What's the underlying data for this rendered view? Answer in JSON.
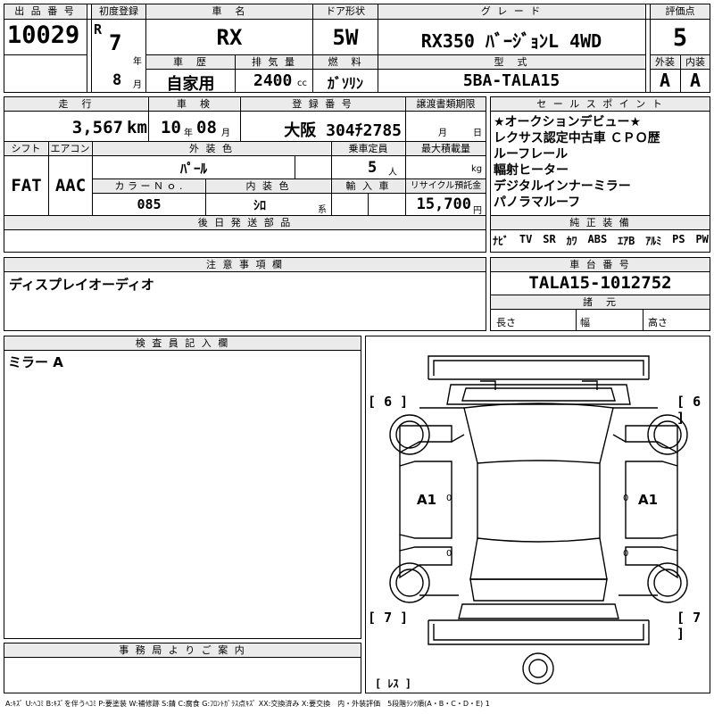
{
  "lot": {
    "header": "出 品 番 号",
    "value": "10029"
  },
  "first_reg": {
    "header": "初度登録",
    "era": "R",
    "year": "7",
    "year_unit": "年",
    "month": "8",
    "month_unit": "月"
  },
  "car_name": {
    "header": "車　名",
    "value": "RX"
  },
  "doors": {
    "header": "ドア形状",
    "value": "5W"
  },
  "grade": {
    "header": "グ レ ー ド",
    "value": "RX350 ﾊﾞｰｼﾞｮﾝL 4WD"
  },
  "score": {
    "header": "評価点",
    "value": "5"
  },
  "history": {
    "header": "車　歴",
    "value": "自家用"
  },
  "displacement": {
    "header": "排 気 量",
    "value": "2400",
    "unit": "cc"
  },
  "fuel": {
    "header": "燃　料",
    "value": "ｶﾞｿﾘﾝ"
  },
  "model": {
    "header": "型　式",
    "value": "5BA-TALA15"
  },
  "exterior_grade": {
    "header": "外装",
    "value": "A"
  },
  "interior_grade": {
    "header": "内装",
    "value": "A"
  },
  "mileage": {
    "header": "走　行",
    "value": "3,567",
    "unit": "km"
  },
  "inspection": {
    "header": "車　検",
    "year": "10",
    "year_unit": "年",
    "month": "08",
    "month_unit": "月"
  },
  "registration": {
    "header": "登 録 番 号",
    "value": "大阪 304ﾁ2785"
  },
  "transfer": {
    "header": "譲渡書類期限",
    "month_unit": "月",
    "day_unit": "日"
  },
  "shift": {
    "header": "シフト",
    "value": "FAT"
  },
  "aircon": {
    "header": "エアコン",
    "value": "AAC"
  },
  "color": {
    "header": "外 装 色",
    "value": "ﾊﾟｰﾙ"
  },
  "capacity": {
    "header": "乗車定員",
    "value": "5",
    "unit": "人"
  },
  "max_load": {
    "header": "最大積載量",
    "unit": "kg"
  },
  "color_no": {
    "header": "カ ラ ー Ｎ ｏ .",
    "value": "085"
  },
  "interior_color": {
    "header": "内 装 色",
    "value": "ｼﾛ",
    "unit": "系"
  },
  "import": {
    "header": "輸 入 車"
  },
  "recycle": {
    "header": "リサイクル預託金",
    "value": "15,700",
    "unit": "円"
  },
  "later_parts": {
    "header": "後 日 発 送 部 品"
  },
  "selling_points": {
    "header": "セ ー ル ス ポ イ ン ト",
    "lines": [
      "★オークションデビュー★",
      "レクサス認定中古車 ＣＰＯ歴",
      "ルーフレール",
      "輻射ヒーター",
      "デジタルインナーミラー",
      "パノラマルーフ"
    ]
  },
  "equipment": {
    "header": "純 正 装 備",
    "items": [
      "ﾅﾋﾞ",
      "TV",
      "SR",
      "ｶﾜ",
      "ABS",
      "ｴｱB",
      "ｱﾙﾐ",
      "PS",
      "PW"
    ]
  },
  "notes": {
    "header": "注 意 事 項 欄",
    "value": "ディスプレイオーディオ"
  },
  "chassis": {
    "header": "車 台 番 号",
    "value": "TALA15-1012752"
  },
  "specs": {
    "header": "諸　元",
    "length": "長さ",
    "width": "幅",
    "height": "高さ"
  },
  "inspector": {
    "header": "検 査 員 記 入 欄",
    "value": "ミラー A"
  },
  "office": {
    "header": "事 務 局 よ り ご 案 内"
  },
  "diagram": {
    "tire_fl": "6",
    "tire_fr": "6",
    "tire_rl": "7",
    "tire_rr": "7",
    "left_damage": "A1",
    "right_damage": "A1",
    "spare": "ﾚｽ",
    "zeros": [
      "0",
      "0",
      "0",
      "0"
    ]
  },
  "legend": "A:ｷｽﾞ U:ﾍｺﾐ B:ｷｽﾞを伴うﾍｺﾐ P:要塗装 W:補修跡 S:錆 C:腐食 G:ﾌﾛﾝﾄｶﾞﾗｽ点ｷｽﾞ XX:交換済み X:要交換　内・外装評価　5段階ﾗﾝｸ順(A・B・C・D・E) 1"
}
